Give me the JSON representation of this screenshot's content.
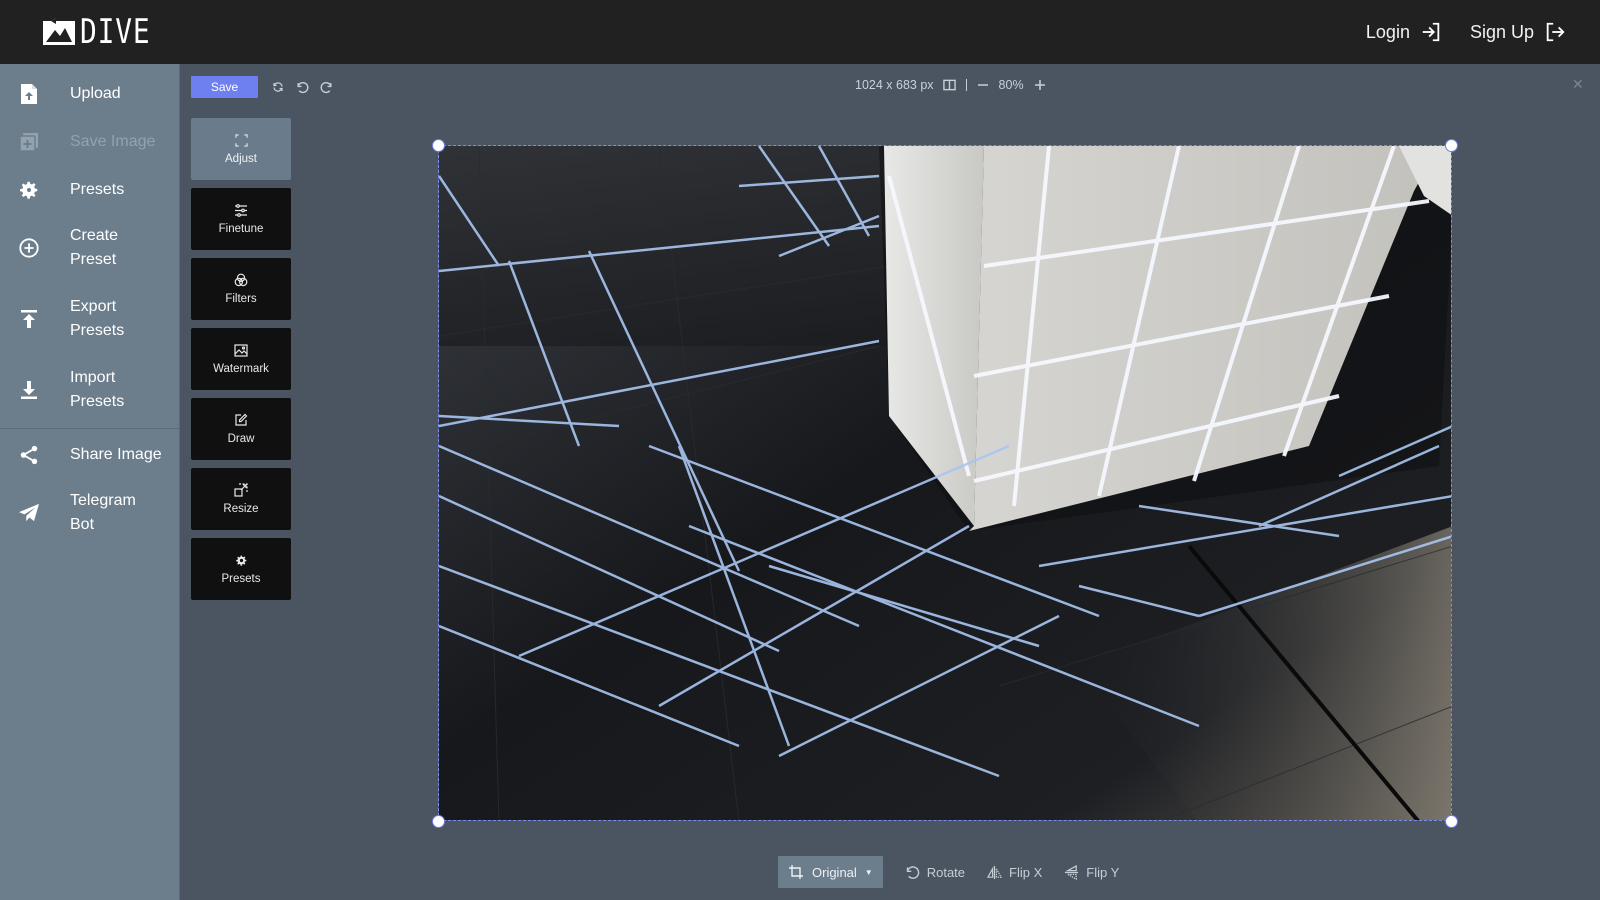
{
  "header": {
    "logo_text": "DIVE",
    "login_label": "Login",
    "signup_label": "Sign Up"
  },
  "sidebar": {
    "items": [
      {
        "label": "Upload",
        "icon": "file-upload-icon",
        "disabled": false
      },
      {
        "label": "Save Image",
        "icon": "save-image-icon",
        "disabled": true
      },
      {
        "label": "Presets",
        "icon": "gear-icon",
        "disabled": false
      },
      {
        "label": "Create\nPreset",
        "icon": "plus-circle-icon",
        "disabled": false
      },
      {
        "label": "Export\nPresets",
        "icon": "export-icon",
        "disabled": false
      },
      {
        "label": "Import\nPresets",
        "icon": "import-icon",
        "disabled": false
      },
      {
        "label": "Share Image",
        "icon": "share-icon",
        "disabled": false
      },
      {
        "label": "Telegram\nBot",
        "icon": "telegram-icon",
        "disabled": false
      }
    ]
  },
  "toolbar": {
    "save_label": "Save"
  },
  "info": {
    "dimensions": "1024 x 683 px",
    "zoom": "80%"
  },
  "tools": [
    {
      "label": "Adjust",
      "icon": "crop-corners-icon",
      "active": true
    },
    {
      "label": "Finetune",
      "icon": "sliders-icon",
      "active": false
    },
    {
      "label": "Filters",
      "icon": "filters-icon",
      "active": false
    },
    {
      "label": "Watermark",
      "icon": "image-icon",
      "active": false
    },
    {
      "label": "Draw",
      "icon": "pencil-icon",
      "active": false
    },
    {
      "label": "Resize",
      "icon": "resize-icon",
      "active": false
    },
    {
      "label": "Presets",
      "icon": "gear-icon",
      "active": false
    }
  ],
  "bottom": {
    "crop_label": "Original",
    "rotate_label": "Rotate",
    "flipx_label": "Flip X",
    "flipy_label": "Flip Y"
  },
  "colors": {
    "accent": "#6e7ff0",
    "topbar": "#212121",
    "sidebar": "#6c7d8c",
    "workspace": "#4a5561"
  }
}
